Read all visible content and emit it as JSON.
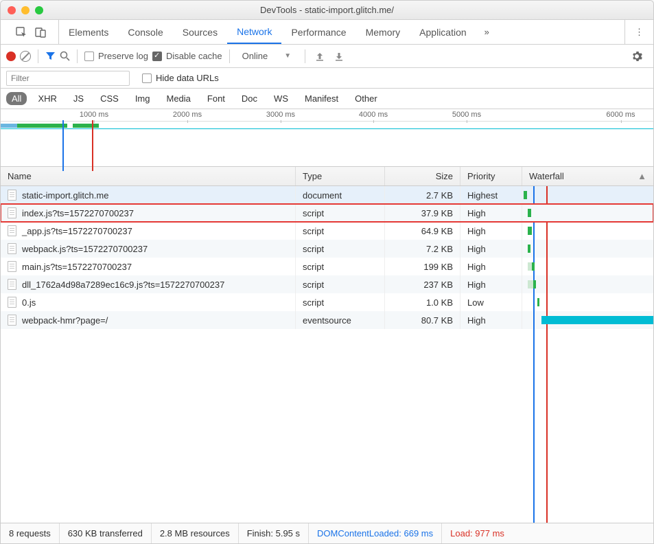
{
  "title": "DevTools - static-import.glitch.me/",
  "tabs": [
    "Elements",
    "Console",
    "Sources",
    "Network",
    "Performance",
    "Memory",
    "Application"
  ],
  "active_tab": "Network",
  "toolbar": {
    "preserve_log": "Preserve log",
    "disable_cache": "Disable cache",
    "online": "Online"
  },
  "filter": {
    "placeholder": "Filter",
    "hide_urls": "Hide data URLs"
  },
  "types": [
    "All",
    "XHR",
    "JS",
    "CSS",
    "Img",
    "Media",
    "Font",
    "Doc",
    "WS",
    "Manifest",
    "Other"
  ],
  "timeline_ticks": [
    "1000 ms",
    "2000 ms",
    "3000 ms",
    "4000 ms",
    "5000 ms",
    "6000 ms"
  ],
  "columns": {
    "name": "Name",
    "type": "Type",
    "size": "Size",
    "priority": "Priority",
    "waterfall": "Waterfall"
  },
  "rows": [
    {
      "name": "static-import.glitch.me",
      "type": "document",
      "size": "2.7 KB",
      "priority": "Highest"
    },
    {
      "name": "index.js?ts=1572270700237",
      "type": "script",
      "size": "37.9 KB",
      "priority": "High"
    },
    {
      "name": "_app.js?ts=1572270700237",
      "type": "script",
      "size": "64.9 KB",
      "priority": "High"
    },
    {
      "name": "webpack.js?ts=1572270700237",
      "type": "script",
      "size": "7.2 KB",
      "priority": "High"
    },
    {
      "name": "main.js?ts=1572270700237",
      "type": "script",
      "size": "199 KB",
      "priority": "High"
    },
    {
      "name": "dll_1762a4d98a7289ec16c9.js?ts=1572270700237",
      "type": "script",
      "size": "237 KB",
      "priority": "High"
    },
    {
      "name": "0.js",
      "type": "script",
      "size": "1.0 KB",
      "priority": "Low"
    },
    {
      "name": "webpack-hmr?page=/",
      "type": "eventsource",
      "size": "80.7 KB",
      "priority": "High"
    }
  ],
  "status": {
    "requests": "8 requests",
    "transferred": "630 KB transferred",
    "resources": "2.8 MB resources",
    "finish": "Finish: 5.95 s",
    "dcl": "DOMContentLoaded: 669 ms",
    "load": "Load: 977 ms"
  }
}
